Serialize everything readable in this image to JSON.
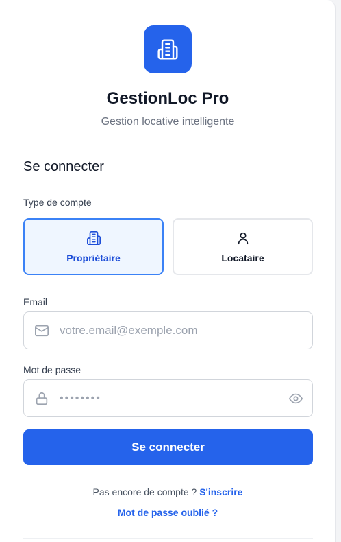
{
  "app": {
    "title": "GestionLoc Pro",
    "subtitle": "Gestion locative intelligente",
    "logo_icon": "building-icon",
    "brand_color": "#2563eb"
  },
  "form": {
    "heading": "Se connecter",
    "account_type": {
      "label": "Type de compte",
      "options": [
        {
          "label": "Propriétaire",
          "icon": "building-icon",
          "selected": true
        },
        {
          "label": "Locataire",
          "icon": "user-icon",
          "selected": false
        }
      ]
    },
    "email": {
      "label": "Email",
      "placeholder": "votre.email@exemple.com",
      "value": "",
      "icon": "mail-icon"
    },
    "password": {
      "label": "Mot de passe",
      "masked_value": "••••••••",
      "icon": "lock-icon",
      "toggle_icon": "eye-icon"
    },
    "submit_label": "Se connecter"
  },
  "footer": {
    "no_account_text": "Pas encore de compte ? ",
    "signup_link": "S'inscrire",
    "forgot_link": "Mot de passe oublié ?"
  }
}
